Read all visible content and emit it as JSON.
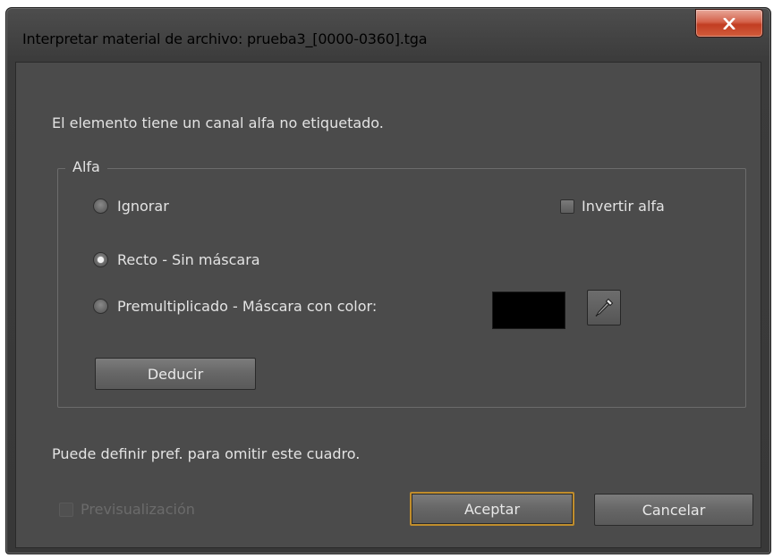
{
  "window": {
    "title": "Interpretar material de archivo: prueba3_[0000-0360].tga",
    "close_icon": "close-x-icon"
  },
  "dialog": {
    "message": "El elemento tiene un canal alfa no etiquetado.",
    "hint": "Puede definir pref. para omitir este cuadro."
  },
  "alpha_group": {
    "legend": "Alfa",
    "options": [
      {
        "label": "Ignorar",
        "checked": false
      },
      {
        "label": "Recto - Sin máscara",
        "checked": true
      },
      {
        "label": "Premultiplicado - Máscara con color:",
        "checked": false
      }
    ],
    "invert_label": "Invertir alfa",
    "invert_checked": false,
    "matte_color": "#000000",
    "eyedropper_icon": "eyedropper-icon",
    "guess_label": "Deducir"
  },
  "footer": {
    "preview_label": "Previsualización",
    "preview_enabled": false,
    "ok_label": "Aceptar",
    "cancel_label": "Cancelar"
  },
  "colors": {
    "accent": "#c08d2c",
    "close": "#c23d22",
    "panel": "#4b4b4b"
  }
}
